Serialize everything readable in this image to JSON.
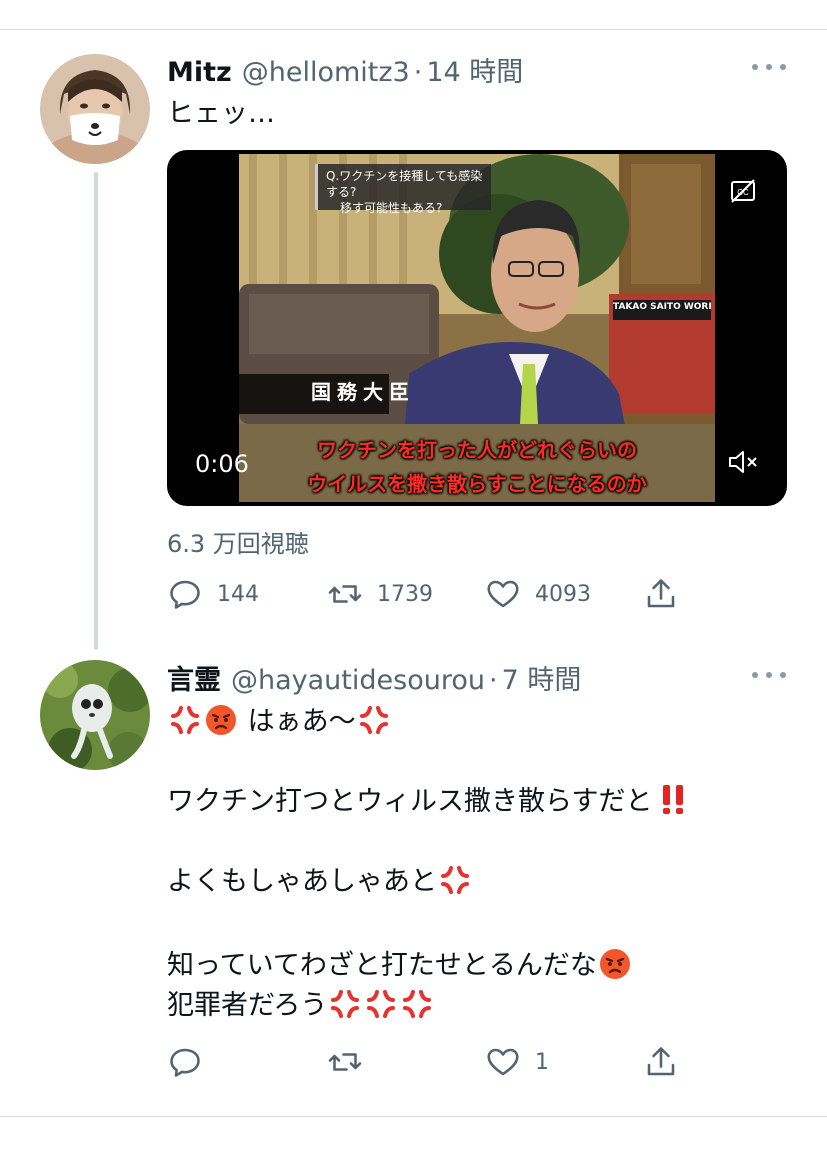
{
  "tweet1": {
    "name": "Mitz",
    "handle": "@hellomitz3",
    "separator": "·",
    "time": "14 時間",
    "text": "ヒェッ…",
    "video": {
      "question_line1": "Q.ワクチンを接種しても感染する?",
      "question_line2": "移す可能性もある?",
      "nameplate": "国務大臣",
      "subtitle_line1": "ワクチンを打った人がどれぐらいの",
      "subtitle_line2": "ウイルスを撒き散らすことになるのか",
      "book_title": "TAKAO SAITO WORKS",
      "elapsed": "0:06"
    },
    "views": "6.3 万回視聴",
    "actions": {
      "reply_count": "144",
      "retweet_count": "1739",
      "like_count": "4093"
    }
  },
  "tweet2": {
    "name": "言霊",
    "handle": "@hayautidesourou",
    "separator": "·",
    "time": "7 時間",
    "line1_text": "はぁあ〜",
    "line2_text": "ワクチン打つとウィルス撒き散らすだと",
    "line3_text": "よくもしゃあしゃあと",
    "line4_text": "知っていてわざと打たせとるんだな",
    "line5_text": "犯罪者だろう",
    "actions": {
      "reply_count": "",
      "retweet_count": "",
      "like_count": "1"
    }
  },
  "colors": {
    "text_primary": "#0f1419",
    "text_secondary": "#536471",
    "thread_line": "#cfd9de",
    "subtitle_red": "#ff2a20"
  },
  "icons": [
    "reply-icon",
    "retweet-icon",
    "like-icon",
    "share-icon",
    "more-icon",
    "captions-icon",
    "mute-icon",
    "anger-symbol-icon",
    "angry-face-icon",
    "double-exclamation-icon"
  ]
}
